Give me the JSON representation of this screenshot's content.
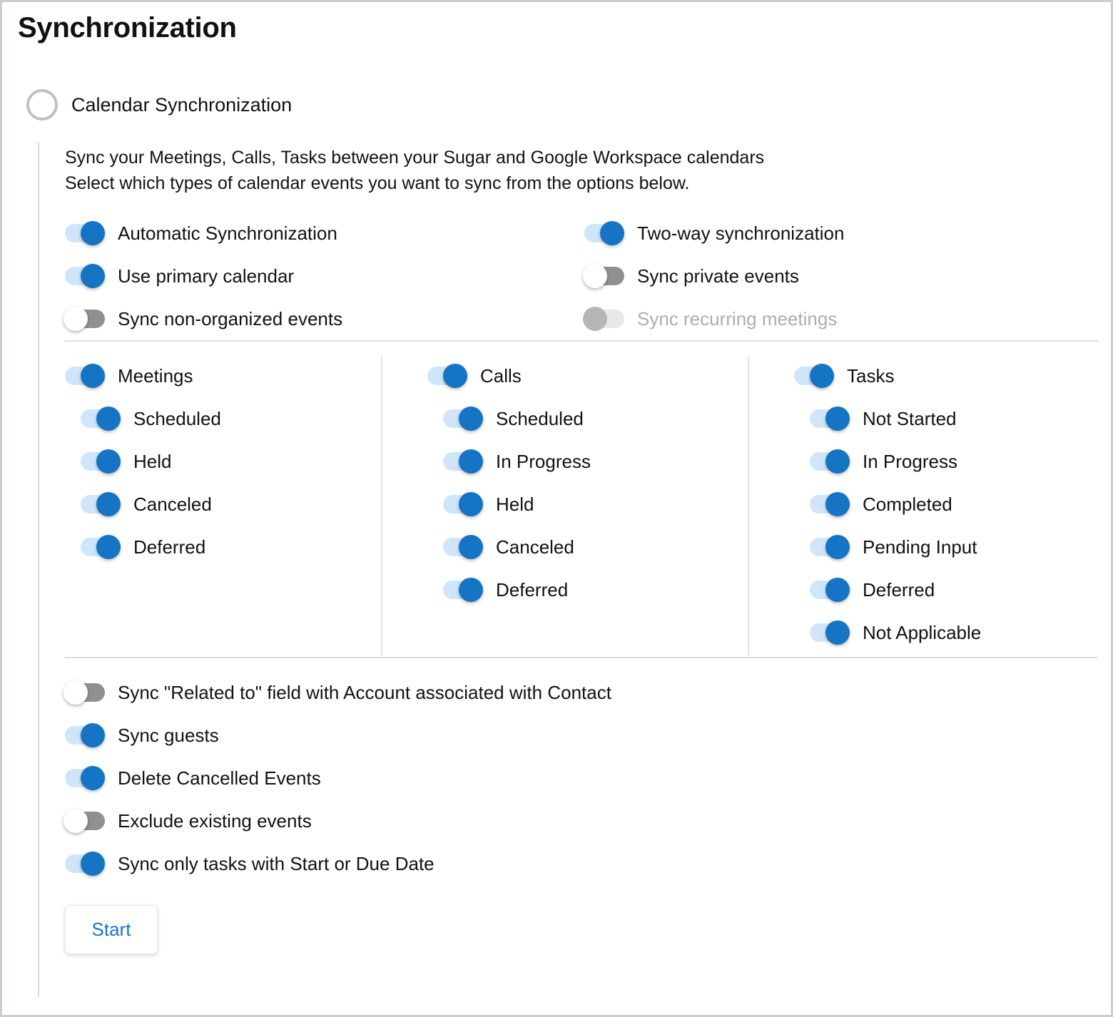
{
  "page": {
    "title": "Synchronization"
  },
  "section": {
    "icon": "circle-outline-icon",
    "label": "Calendar Synchronization",
    "description_line1": "Sync your Meetings, Calls, Tasks between your Sugar and Google Workspace calendars",
    "description_line2": "Select which types of calendar events you want to sync from the options below."
  },
  "colors": {
    "toggle_on_track": "#cfe6fa",
    "toggle_on_knob": "#1574c4",
    "toggle_off_track": "#909090",
    "toggle_off_knob": "#ffffff",
    "toggle_disabled_track": "#e8e8e8",
    "toggle_disabled_knob": "#b6b6b6",
    "accent_link": "#1a73c8",
    "separator": "#dcdcdc",
    "ring_border": "#bfbfbf",
    "page_border": "#c9ccd1"
  },
  "top_options": {
    "left": [
      {
        "label": "Automatic Synchronization",
        "state": "on"
      },
      {
        "label": "Use primary calendar",
        "state": "on"
      },
      {
        "label": "Sync non-organized events",
        "state": "off"
      }
    ],
    "right": [
      {
        "label": "Two-way synchronization",
        "state": "on"
      },
      {
        "label": "Sync private events",
        "state": "off"
      },
      {
        "label": "Sync recurring meetings",
        "state": "disabled"
      }
    ]
  },
  "module_columns": [
    {
      "parent": {
        "label": "Meetings",
        "state": "on"
      },
      "children": [
        {
          "label": "Scheduled",
          "state": "on"
        },
        {
          "label": "Held",
          "state": "on"
        },
        {
          "label": "Canceled",
          "state": "on"
        },
        {
          "label": "Deferred",
          "state": "on"
        }
      ]
    },
    {
      "parent": {
        "label": "Calls",
        "state": "on"
      },
      "children": [
        {
          "label": "Scheduled",
          "state": "on"
        },
        {
          "label": "In Progress",
          "state": "on"
        },
        {
          "label": "Held",
          "state": "on"
        },
        {
          "label": "Canceled",
          "state": "on"
        },
        {
          "label": "Deferred",
          "state": "on"
        }
      ]
    },
    {
      "parent": {
        "label": "Tasks",
        "state": "on"
      },
      "children": [
        {
          "label": "Not Started",
          "state": "on"
        },
        {
          "label": "In Progress",
          "state": "on"
        },
        {
          "label": "Completed",
          "state": "on"
        },
        {
          "label": "Pending Input",
          "state": "on"
        },
        {
          "label": "Deferred",
          "state": "on"
        },
        {
          "label": "Not Applicable",
          "state": "on"
        }
      ]
    }
  ],
  "bottom_options": [
    {
      "label": "Sync \"Related to\" field with Account associated with Contact",
      "state": "off"
    },
    {
      "label": "Sync guests",
      "state": "on"
    },
    {
      "label": "Delete Cancelled Events",
      "state": "on"
    },
    {
      "label": "Exclude existing events",
      "state": "off"
    },
    {
      "label": "Sync only tasks with Start or Due Date",
      "state": "on"
    }
  ],
  "actions": {
    "start_label": "Start"
  }
}
